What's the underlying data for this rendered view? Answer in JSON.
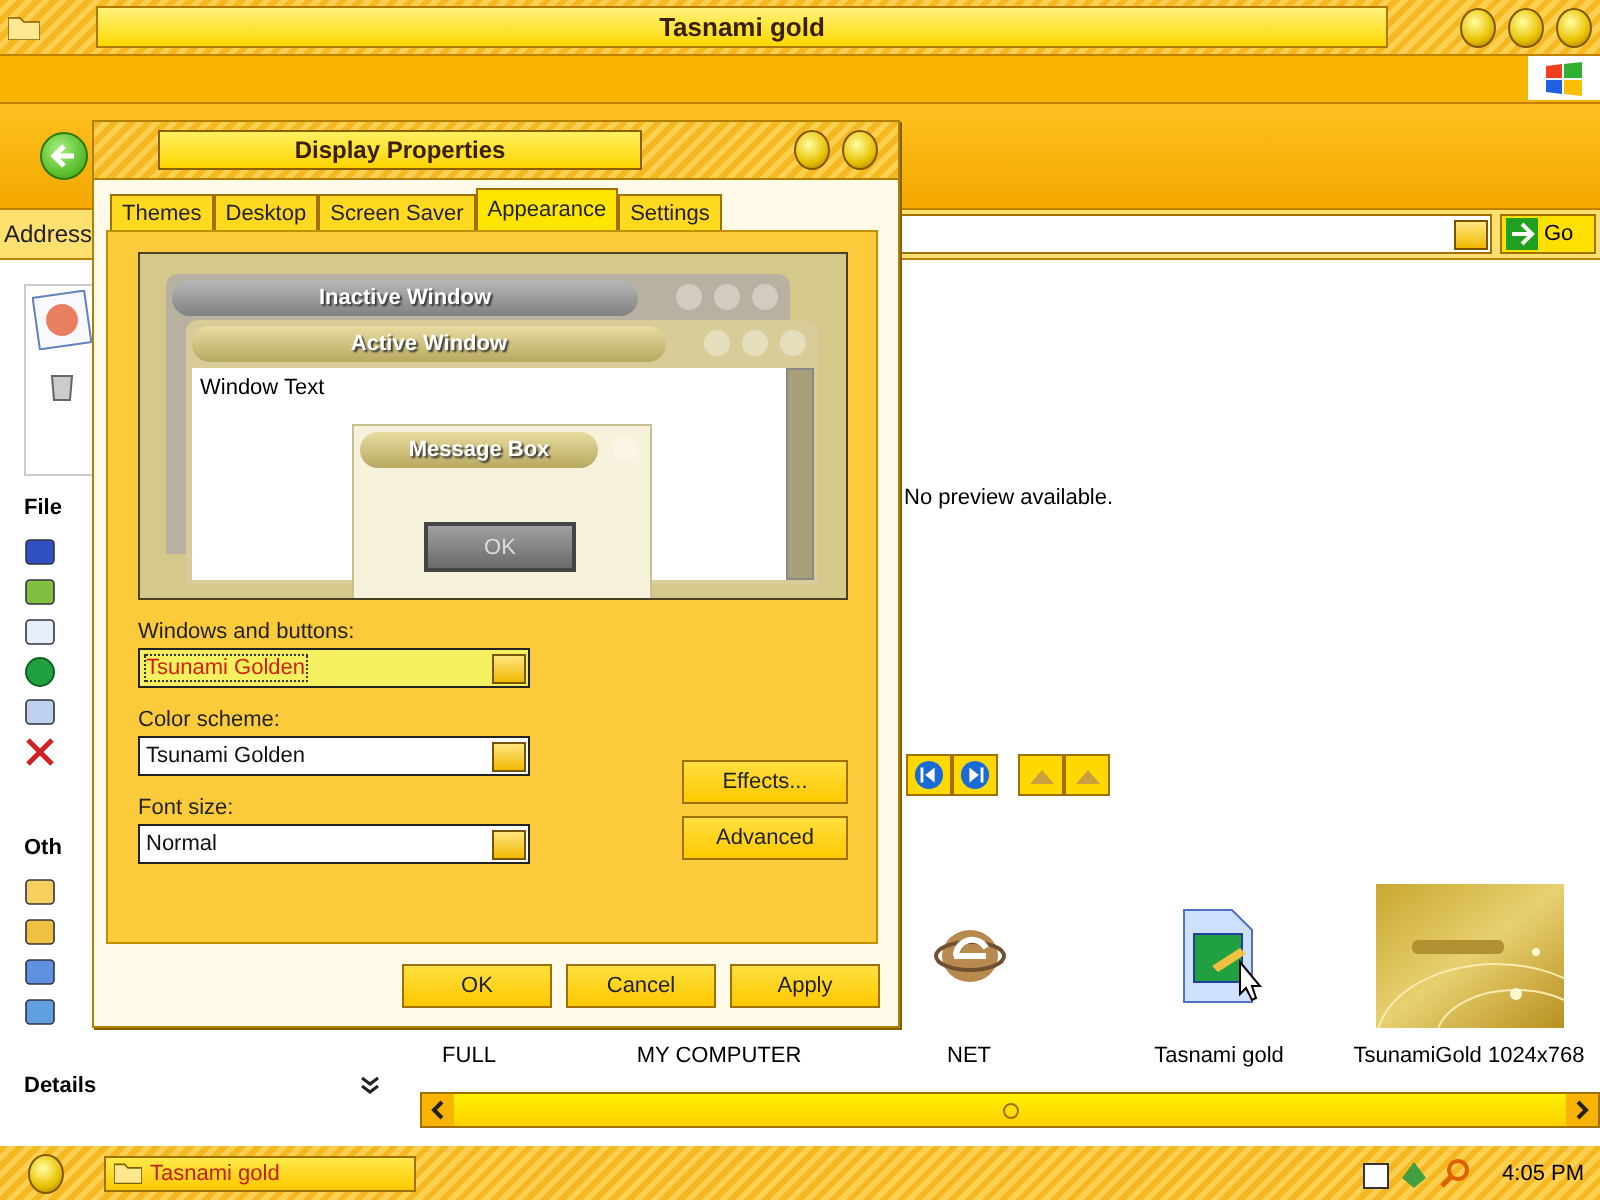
{
  "window": {
    "title": "Tasnami gold"
  },
  "address": {
    "label": "Address",
    "go": "Go"
  },
  "left_pane": {
    "sections": [
      "File",
      "Oth"
    ],
    "details": "Details"
  },
  "preview_text": "No preview available.",
  "files": [
    {
      "name": "FULL"
    },
    {
      "name": "MY COMPUTER"
    },
    {
      "name": "NET",
      "kind": "web"
    },
    {
      "name": "Tasnami gold",
      "kind": "theme"
    },
    {
      "name": "TsunamiGold 1024x768",
      "kind": "picture"
    }
  ],
  "taskbar": {
    "task": "Tasnami gold",
    "clock": "4:05 PM"
  },
  "dialog": {
    "title": "Display Properties",
    "tabs": [
      {
        "label": "Themes",
        "selected": false
      },
      {
        "label": "Desktop",
        "selected": false
      },
      {
        "label": "Screen Saver",
        "selected": false
      },
      {
        "label": "Appearance",
        "selected": true
      },
      {
        "label": "Settings",
        "selected": false
      }
    ],
    "preview": {
      "inactive": "Inactive Window",
      "active": "Active Window",
      "window_text": "Window Text",
      "message_box": "Message Box",
      "ok": "OK"
    },
    "fields": [
      {
        "label": "Windows and buttons:",
        "value": "Tsunami Golden",
        "focused": true
      },
      {
        "label": "Color scheme:",
        "value": "Tsunami Golden",
        "focused": false
      },
      {
        "label": "Font size:",
        "value": "Normal",
        "focused": false
      }
    ],
    "side_buttons": [
      "Effects...",
      "Advanced"
    ],
    "buttons": [
      "OK",
      "Cancel",
      "Apply"
    ]
  }
}
